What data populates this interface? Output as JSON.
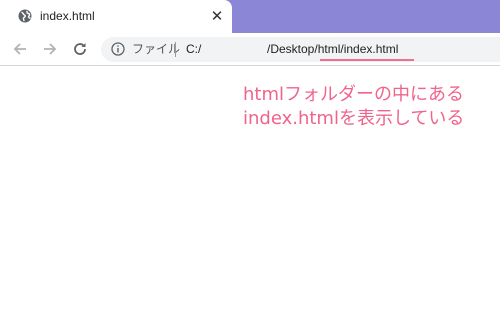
{
  "tab": {
    "title": "index.html",
    "icon": "globe-icon",
    "close_label": "✕"
  },
  "toolbar": {
    "back_icon": "arrow-left-icon",
    "forward_icon": "arrow-right-icon",
    "reload_icon": "reload-icon"
  },
  "address_bar": {
    "info_icon": "info-icon",
    "scheme_label": "ファイル",
    "url_prefix": "C:/",
    "url_path": "/Desktop/html/index.html"
  },
  "annotation": {
    "line1": "htmlフォルダーの中にある",
    "line2": "index.htmlを表示している",
    "color": "#f0648c"
  },
  "colors": {
    "tabstrip": "#8b86d6",
    "highlight": "#ef6e92"
  }
}
